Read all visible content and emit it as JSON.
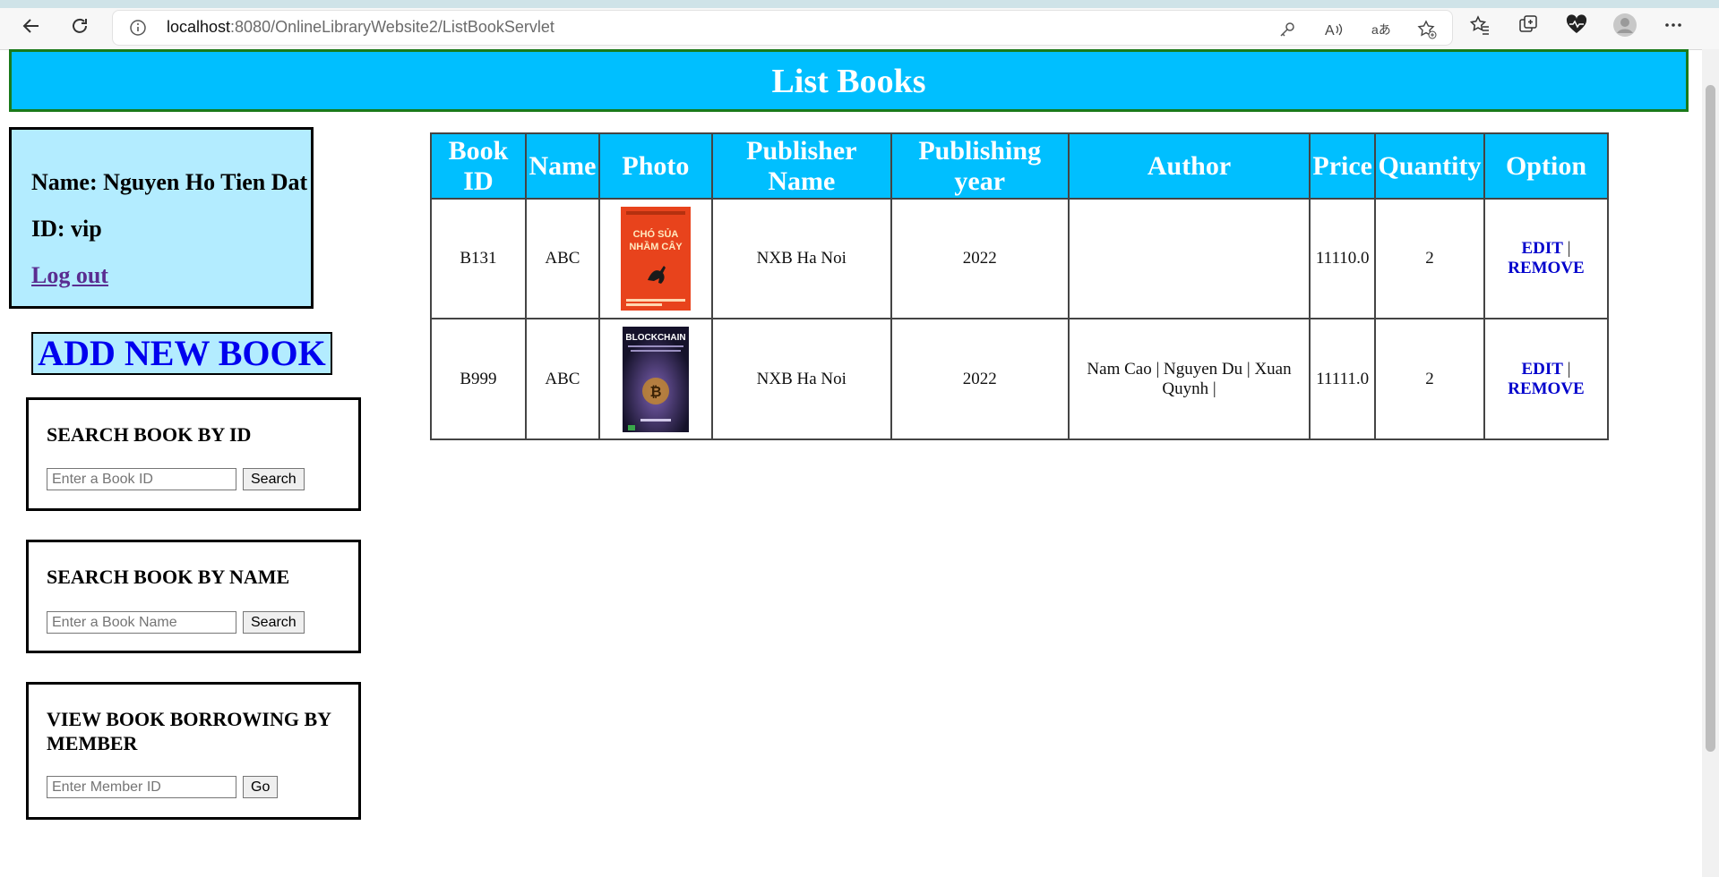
{
  "browser": {
    "url_host": "localhost",
    "url_rest": ":8080/OnlineLibraryWebsite2/ListBookServlet",
    "icons": [
      "back-icon",
      "refresh-icon",
      "info-icon",
      "key-icon",
      "read-aloud-icon",
      "translate-icon",
      "add-favorite-icon",
      "favorites-icon",
      "collections-icon",
      "health-icon",
      "profile-icon",
      "more-icon"
    ]
  },
  "header": {
    "title": "List Books"
  },
  "user": {
    "name_label": "Name: Nguyen Ho Tien Dat",
    "id_label": "ID: vip",
    "logout": "Log out"
  },
  "actions": {
    "add_new_book": "ADD NEW BOOK"
  },
  "search_id": {
    "title": "SEARCH BOOK BY ID",
    "placeholder": "Enter a Book ID",
    "button": "Search"
  },
  "search_name": {
    "title": "SEARCH BOOK BY NAME",
    "placeholder": "Enter a Book Name",
    "button": "Search"
  },
  "borrowing": {
    "title": "VIEW BOOK BORROWING BY MEMBER",
    "placeholder": "Enter Member ID",
    "button": "Go"
  },
  "table": {
    "headers": [
      "Book ID",
      "Name",
      "Photo",
      "Publisher Name",
      "Publishing year",
      "Author",
      "Price",
      "Quantity",
      "Option"
    ],
    "rows": [
      {
        "id": "B131",
        "name": "ABC",
        "cover": "CHÓ SỦA NHẦM CÂY",
        "publisher": "NXB Ha Noi",
        "year": "2022",
        "author": "",
        "price": "11110.0",
        "quantity": "2",
        "edit": "EDIT",
        "sep": "|",
        "remove": "REMOVE"
      },
      {
        "id": "B999",
        "name": "ABC",
        "cover": "BLOCKCHAIN",
        "publisher": "NXB Ha Noi",
        "year": "2022",
        "author": "Nam Cao | Nguyen Du | Xuan Quynh |",
        "price": "11111.0",
        "quantity": "2",
        "edit": "EDIT",
        "sep": "|",
        "remove": "REMOVE"
      }
    ]
  },
  "colors": {
    "banner": "#00bfff",
    "panel_bg": "#b3ecff",
    "link": "#0000cc"
  }
}
